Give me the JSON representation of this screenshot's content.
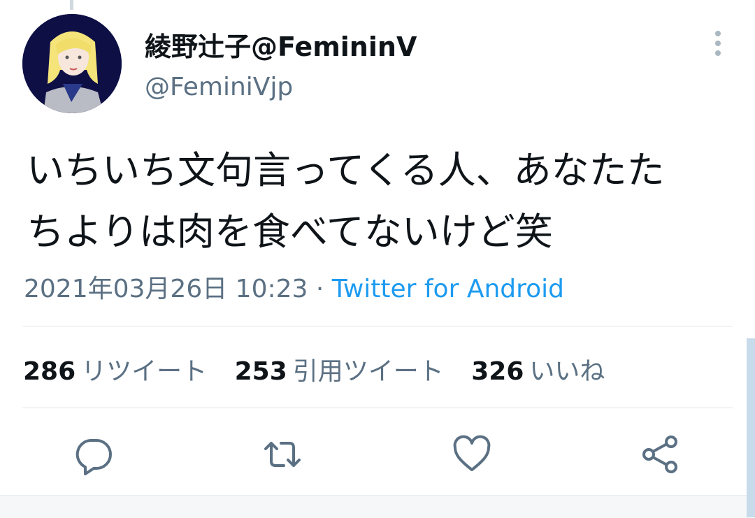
{
  "tweet": {
    "display_name": "綾野辻子@FemininV",
    "handle": "@FeminiVjp",
    "text_line1": "いちいち文句言ってくる人、あなたた",
    "text_line2": "ちよりは肉を食べてないけど笑",
    "timestamp": "2021年03月26日 10:23",
    "separator": " · ",
    "source": "Twitter for Android"
  },
  "stats": {
    "retweets": {
      "count": "286",
      "label": "リツイート"
    },
    "quotes": {
      "count": "253",
      "label": "引用ツイート"
    },
    "likes": {
      "count": "326",
      "label": "いいね"
    }
  },
  "icons": {
    "more": "vertical-ellipsis-icon",
    "reply": "reply-icon",
    "retweet": "retweet-icon",
    "like": "heart-icon",
    "share": "share-icon"
  },
  "colors": {
    "link": "#1d9bf0",
    "secondary_text": "#5b7083",
    "icon": "#5b7083"
  }
}
